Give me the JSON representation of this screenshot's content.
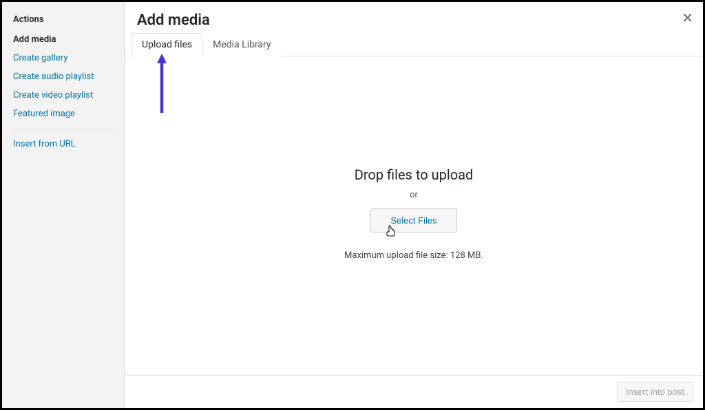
{
  "sidebar": {
    "title": "Actions",
    "current": "Add media",
    "links": [
      "Create gallery",
      "Create audio playlist",
      "Create video playlist",
      "Featured image"
    ],
    "insert_url": "Insert from URL"
  },
  "modal": {
    "title": "Add media",
    "tabs": {
      "upload": "Upload files",
      "library": "Media Library"
    },
    "drop_text": "Drop files to upload",
    "or_text": "or",
    "select_btn": "Select Files",
    "max_size": "Maximum upload file size: 128 MB.",
    "insert_btn": "Insert into post"
  }
}
